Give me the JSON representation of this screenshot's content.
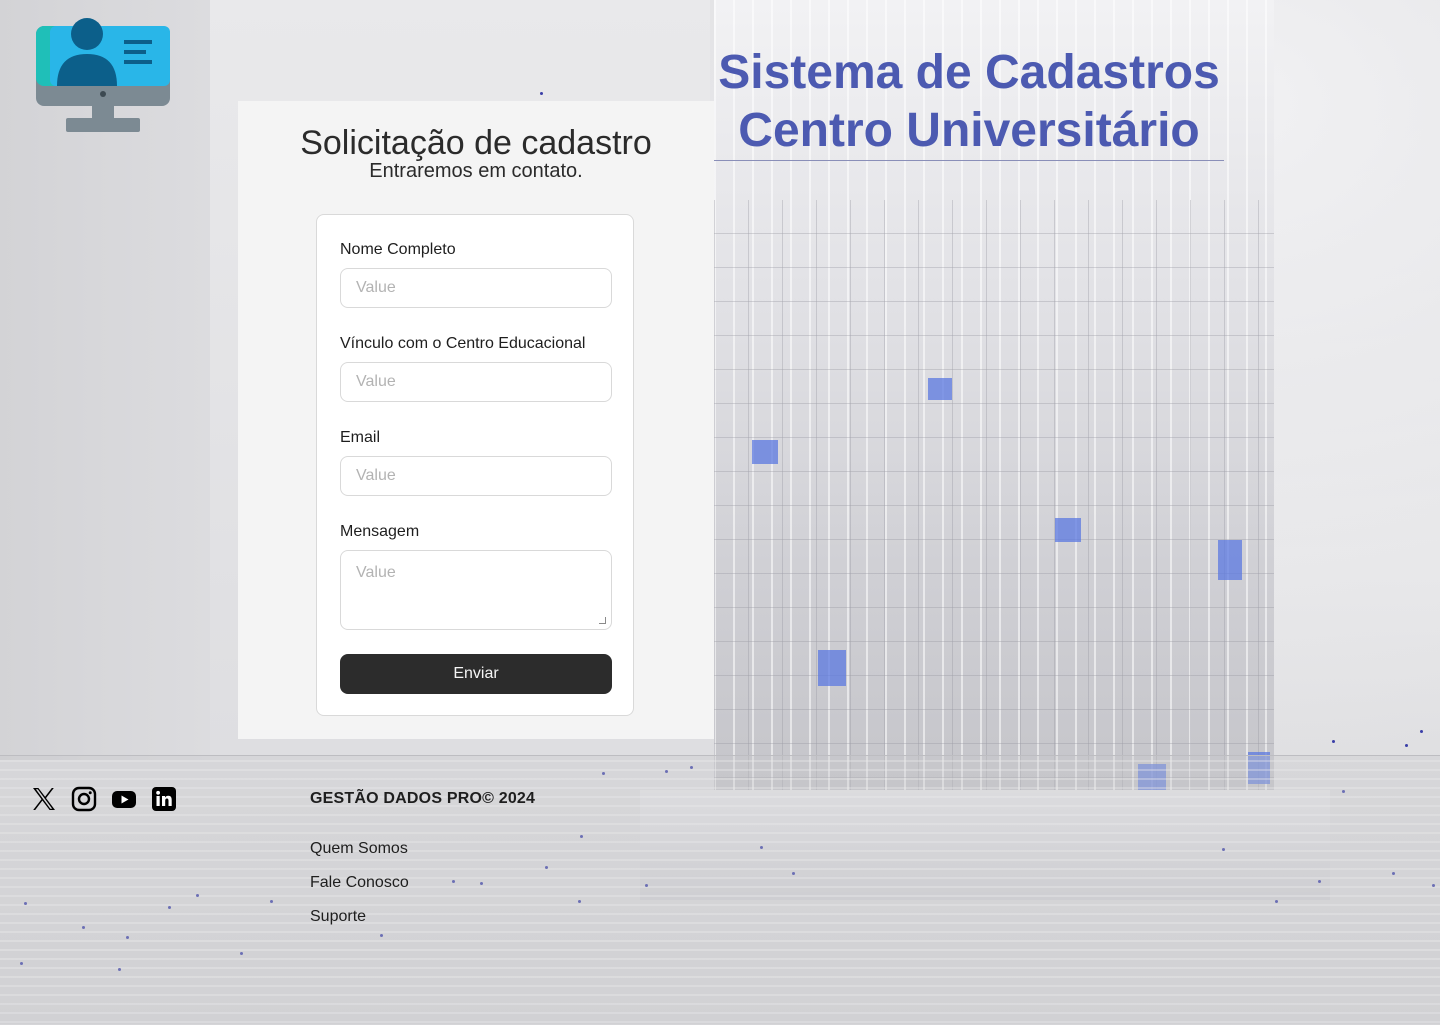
{
  "header": {
    "title_line1": "Sistema de Cadastros",
    "title_line2": "Centro Universitário"
  },
  "logo": {
    "icon": "monitor-user-icon"
  },
  "form": {
    "title": "Solicitação de cadastro",
    "subtitle": "Entraremos em contato.",
    "fields": [
      {
        "label": "Nome Completo",
        "placeholder": "Value",
        "value": ""
      },
      {
        "label": "Vínculo com o Centro Educacional",
        "placeholder": "Value",
        "value": ""
      },
      {
        "label": "Email",
        "placeholder": "Value",
        "value": ""
      },
      {
        "label": "Mensagem",
        "placeholder": "Value",
        "value": ""
      }
    ],
    "submit_label": "Enviar"
  },
  "footer": {
    "social": [
      "x-icon",
      "instagram-icon",
      "youtube-icon",
      "linkedin-icon"
    ],
    "brand": "GESTÃO DADOS PRO© 2024",
    "links": [
      "Quem Somos",
      "Fale Conosco",
      "Suporte"
    ]
  },
  "colors": {
    "title": "#4c5ab1",
    "button_bg": "#2c2c2c",
    "panel_bg": "#f4f4f4",
    "logo_teal": "#1fbfb8",
    "logo_blue": "#29b6e8",
    "logo_dark": "#0c5f8a",
    "logo_gray": "#7c8a93"
  }
}
